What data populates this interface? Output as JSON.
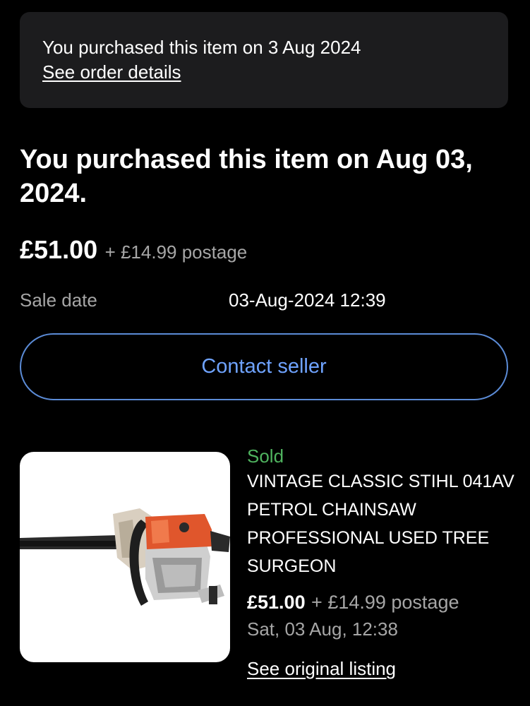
{
  "banner": {
    "text": "You purchased this item on 3 Aug 2024",
    "link": "See order details"
  },
  "headline": "You purchased this item on Aug 03, 2024.",
  "price": {
    "amount": "£51.00",
    "postage": "+ £14.99 postage"
  },
  "sale": {
    "label": "Sale date",
    "value": "03-Aug-2024 12:39"
  },
  "contact_button": "Contact seller",
  "item": {
    "status": "Sold",
    "title": "VINTAGE CLASSIC STIHL 041AV PETROL CHAINSAW PROFESSIONAL USED TREE SURGEON",
    "price": "£51.00",
    "postage": "+ £14.99 postage",
    "date": "Sat, 03 Aug, 12:38",
    "link": "See original listing",
    "image_icon": "chainsaw-photo"
  },
  "colors": {
    "background": "#000000",
    "banner": "#1c1c1e",
    "accent": "#6fa3ff",
    "sold": "#4fb35f",
    "muted": "#a6a6a6"
  }
}
